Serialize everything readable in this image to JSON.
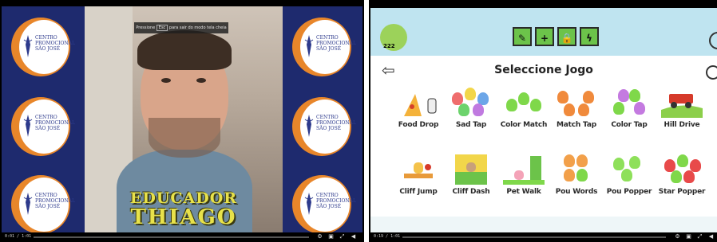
{
  "left_video": {
    "fullscreen_prompt": {
      "before": "Pressione",
      "key": "Esc",
      "after": "para sair do modo tela cheia"
    },
    "title_line1": "EDUCADOR",
    "title_line2": "THIAGO",
    "logo_text": "CENTRO PROMOCIONAL SÃO JOSÉ",
    "time": "0:01 / 1:01"
  },
  "right_video": {
    "coins": "222",
    "heading": "Seleccione Jogo",
    "topbar_buttons": [
      "brush",
      "plus",
      "lock",
      "bolt"
    ],
    "games_row1": [
      "Food Drop",
      "Sad Tap",
      "Color Match",
      "Match Tap",
      "Color Tap",
      "Hill Drive"
    ],
    "games_row2": [
      "Cliff Jump",
      "Cliff Dash",
      "Pet Walk",
      "Pou Words",
      "Pou Popper",
      "Star Popper"
    ],
    "time": "0:19 / 1:01"
  },
  "colors": {
    "navy": "#1e2a6e",
    "logo_orange": "#e8862a",
    "title_yellow": "#e8e24a",
    "topbar_blue": "#bfe4f0",
    "button_green": "#6cc34a"
  }
}
